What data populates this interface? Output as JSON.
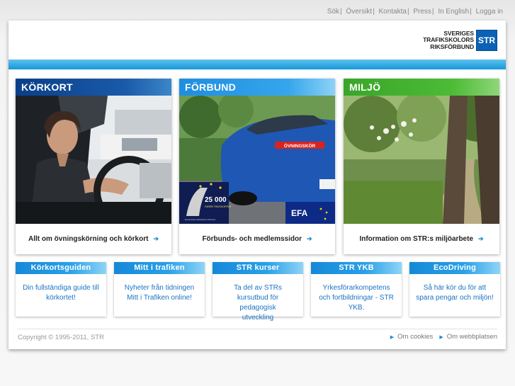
{
  "topnav": [
    "Sök",
    "Översikt",
    "Kontakta",
    "Press",
    "In English",
    "Logga in"
  ],
  "logo": {
    "line1": "SVERIGES",
    "line2": "TRAFIKSKOLORS",
    "line3": "RIKSFÖRBUND",
    "mark": "STR"
  },
  "cards": [
    {
      "title": "KÖRKORT",
      "link": "Allt om övningskörning och körkort"
    },
    {
      "title": "FÖRBUND",
      "link": "Förbunds- och medlemssidor"
    },
    {
      "title": "MILJÖ",
      "link": "Information om STR:s miljöarbete"
    }
  ],
  "car_image": {
    "plate_text": "ÖVNINGSKÖR",
    "badge_number": "25 000",
    "badge_caption": "FÄRRE TRAFIKOFFER",
    "badge_sub": "Europeiska trafikskolors förbund",
    "efa": "EFA"
  },
  "boxes": [
    {
      "title": "Körkortsguiden",
      "text": "Din fullständiga guide till körkortet!"
    },
    {
      "title": "Mitt i trafiken",
      "text": "Nyheter från tidningen Mitt i Trafiken online!"
    },
    {
      "title": "STR kurser",
      "text": "Ta del av STRs kursutbud för pedagogisk utveckling"
    },
    {
      "title": "STR YKB",
      "text": "Yrkesförarkompetens och fortbildningar - STR YKB."
    },
    {
      "title": "EcoDriving",
      "text": "Så här kör du för att spara pengar och miljön!"
    }
  ],
  "footer": {
    "copyright": "Copyright © 1995-2011, STR",
    "links": [
      "Om cookies",
      "Om webbplatsen"
    ]
  },
  "colors": {
    "accent_blue": "#1897d8",
    "korkort_header": "#0a3f8a",
    "forbund_header": "#1f8de0",
    "miljo_header": "#3aa52a",
    "link_blue": "#1a73c4"
  }
}
